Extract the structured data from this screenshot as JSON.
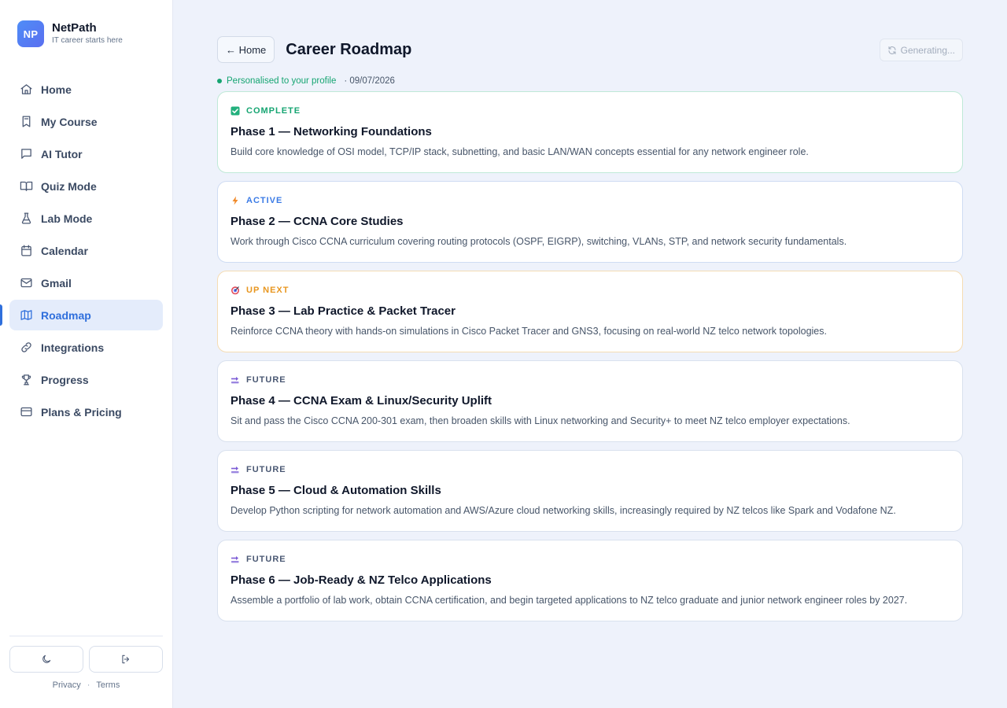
{
  "brand": {
    "logo": "NP",
    "name": "NetPath",
    "tagline": "IT career starts here"
  },
  "nav": [
    {
      "label": "Home",
      "icon": "home-icon"
    },
    {
      "label": "My Course",
      "icon": "book-icon"
    },
    {
      "label": "AI Tutor",
      "icon": "chat-icon"
    },
    {
      "label": "Quiz Mode",
      "icon": "open-book-icon"
    },
    {
      "label": "Lab Mode",
      "icon": "flask-icon"
    },
    {
      "label": "Calendar",
      "icon": "calendar-icon"
    },
    {
      "label": "Gmail",
      "icon": "mail-icon"
    },
    {
      "label": "Roadmap",
      "icon": "map-icon",
      "active": true
    },
    {
      "label": "Integrations",
      "icon": "link-icon"
    },
    {
      "label": "Progress",
      "icon": "trophy-icon"
    },
    {
      "label": "Plans & Pricing",
      "icon": "credit-card-icon"
    }
  ],
  "footer": {
    "privacy": "Privacy",
    "terms": "Terms",
    "separator": "·"
  },
  "header": {
    "back_label": "← Home",
    "title": "Career Roadmap",
    "generate_label": "Generating..."
  },
  "meta": {
    "personalised": "Personalised to your profile",
    "date": "· 09/07/2026"
  },
  "colors": {
    "accent": "#2f6fdc",
    "complete": "#16a572",
    "active": "#3b7be6",
    "next": "#e8961f",
    "future": "#4a5873"
  },
  "phases": [
    {
      "status": "COMPLETE",
      "kind": "complete",
      "icon": "check-box-icon",
      "title": "Phase 1 — Networking Foundations",
      "desc": "Build core knowledge of OSI model, TCP/IP stack, subnetting, and basic LAN/WAN concepts essential for any network engineer role."
    },
    {
      "status": "ACTIVE",
      "kind": "active",
      "icon": "lightning-icon",
      "title": "Phase 2 — CCNA Core Studies",
      "desc": "Work through Cisco CCNA curriculum covering routing protocols (OSPF, EIGRP), switching, VLANs, STP, and network security fundamentals."
    },
    {
      "status": "UP NEXT",
      "kind": "next",
      "icon": "target-icon",
      "title": "Phase 3 — Lab Practice & Packet Tracer",
      "desc": "Reinforce CCNA theory with hands-on simulations in Cisco Packet Tracer and GNS3, focusing on real-world NZ telco network topologies."
    },
    {
      "status": "FUTURE",
      "kind": "future",
      "icon": "soon-arrow-icon",
      "title": "Phase 4 — CCNA Exam & Linux/Security Uplift",
      "desc": "Sit and pass the Cisco CCNA 200-301 exam, then broaden skills with Linux networking and Security+ to meet NZ telco employer expectations."
    },
    {
      "status": "FUTURE",
      "kind": "future",
      "icon": "soon-arrow-icon",
      "title": "Phase 5 — Cloud & Automation Skills",
      "desc": "Develop Python scripting for network automation and AWS/Azure cloud networking skills, increasingly required by NZ telcos like Spark and Vodafone NZ."
    },
    {
      "status": "FUTURE",
      "kind": "future",
      "icon": "soon-arrow-icon",
      "title": "Phase 6 — Job-Ready & NZ Telco Applications",
      "desc": "Assemble a portfolio of lab work, obtain CCNA certification, and begin targeted applications to NZ telco graduate and junior network engineer roles by 2027."
    }
  ]
}
